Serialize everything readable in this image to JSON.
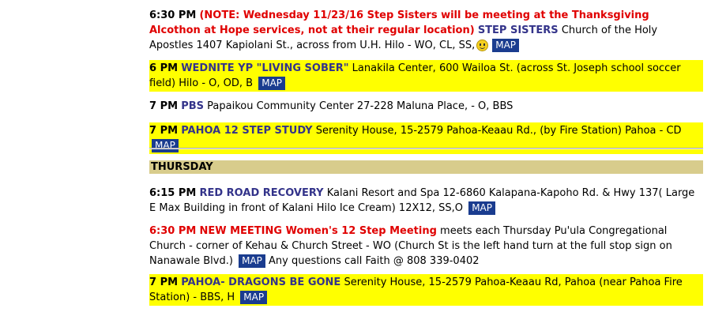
{
  "map_label": "MAP",
  "entries_top": [
    {
      "time": "6:30 PM",
      "note": "(NOTE: Wednesday 11/23/16 Step Sisters will be meeting at the Thanksgiving Alcothon at Hope services, not at their regular location)",
      "name": "STEP SISTERS",
      "details": "Church of the Holy Apostles 1407 Kapiolani St., across from U.H. Hilo - WO, CL, SS,"
    },
    {
      "time": "6 PM",
      "name": "WEDNITE YP \"LIVING SOBER\"",
      "details": "Lanakila Center, 600 Wailoa St. (across St. Joseph school soccer field) Hilo - O, OD, B"
    },
    {
      "time": "7 PM",
      "name": "PBS",
      "details": "Papaikou Community Center 27-228 Maluna Place, - O, BBS"
    },
    {
      "time": "7 PM",
      "name": "PAHOA 12 STEP STUDY",
      "details": "Serenity House, 15-2579 Pahoa-Keaau Rd., (by Fire Station) Pahoa - CD"
    }
  ],
  "day_header": "THURSDAY",
  "entries_bottom": [
    {
      "time": "6:15 PM",
      "name": "RED ROAD RECOVERY",
      "details": "Kalani Resort and Spa 12-6860 Kalapana-Kapoho Rd. & Hwy 137( Large E Max Building in front of Kalani Hilo Ice Cream) 12X12, SS,O"
    },
    {
      "time": "6:30 PM",
      "name": "NEW MEETING Women's 12 Step Meeting",
      "details": "meets each Thursday Pu'ula Congregational Church - corner of Kehau & Church Street - WO (Church St is the left hand turn at the full stop sign on Nanawale Blvd.)",
      "after": "Any questions call Faith @ 808 339-0402"
    },
    {
      "time": "7 PM",
      "name": "PAHOA- DRAGONS BE GONE",
      "details": "Serenity House, 15-2579 Pahoa-Keaau Rd, Pahoa (near Pahoa Fire Station) - BBS, H"
    }
  ]
}
